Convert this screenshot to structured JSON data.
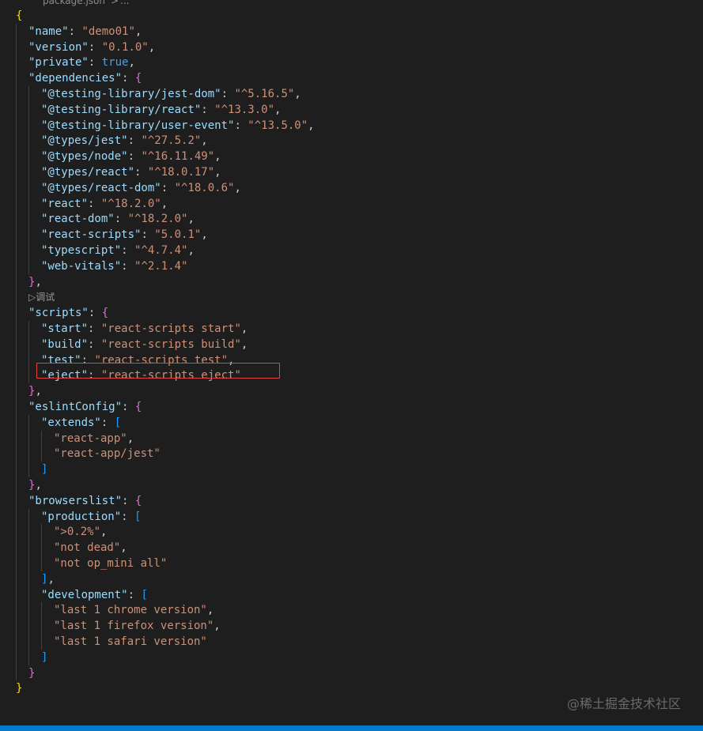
{
  "breadcrumb": {
    "file": "package.json",
    "separator": ">",
    "node": "..."
  },
  "codelens": {
    "label": "调试",
    "icon": "play-outline-icon"
  },
  "watermark": "@稀土掘金技术社区",
  "lines": [
    [
      [
        "b1",
        "{"
      ]
    ],
    [
      [
        "k",
        "\"name\""
      ],
      [
        "c",
        ": "
      ],
      [
        "s",
        "\"demo01\""
      ],
      [
        "c",
        ","
      ]
    ],
    [
      [
        "k",
        "\"version\""
      ],
      [
        "c",
        ": "
      ],
      [
        "s",
        "\"0.1.0\""
      ],
      [
        "c",
        ","
      ]
    ],
    [
      [
        "k",
        "\"private\""
      ],
      [
        "c",
        ": "
      ],
      [
        "kw",
        "true"
      ],
      [
        "c",
        ","
      ]
    ],
    [
      [
        "k",
        "\"dependencies\""
      ],
      [
        "c",
        ": "
      ],
      [
        "b2",
        "{"
      ]
    ],
    [
      [
        "k",
        "\"@testing-library/jest-dom\""
      ],
      [
        "c",
        ": "
      ],
      [
        "s",
        "\"^5.16.5\""
      ],
      [
        "c",
        ","
      ]
    ],
    [
      [
        "k",
        "\"@testing-library/react\""
      ],
      [
        "c",
        ": "
      ],
      [
        "s",
        "\"^13.3.0\""
      ],
      [
        "c",
        ","
      ]
    ],
    [
      [
        "k",
        "\"@testing-library/user-event\""
      ],
      [
        "c",
        ": "
      ],
      [
        "s",
        "\"^13.5.0\""
      ],
      [
        "c",
        ","
      ]
    ],
    [
      [
        "k",
        "\"@types/jest\""
      ],
      [
        "c",
        ": "
      ],
      [
        "s",
        "\"^27.5.2\""
      ],
      [
        "c",
        ","
      ]
    ],
    [
      [
        "k",
        "\"@types/node\""
      ],
      [
        "c",
        ": "
      ],
      [
        "s",
        "\"^16.11.49\""
      ],
      [
        "c",
        ","
      ]
    ],
    [
      [
        "k",
        "\"@types/react\""
      ],
      [
        "c",
        ": "
      ],
      [
        "s",
        "\"^18.0.17\""
      ],
      [
        "c",
        ","
      ]
    ],
    [
      [
        "k",
        "\"@types/react-dom\""
      ],
      [
        "c",
        ": "
      ],
      [
        "s",
        "\"^18.0.6\""
      ],
      [
        "c",
        ","
      ]
    ],
    [
      [
        "k",
        "\"react\""
      ],
      [
        "c",
        ": "
      ],
      [
        "s",
        "\"^18.2.0\""
      ],
      [
        "c",
        ","
      ]
    ],
    [
      [
        "k",
        "\"react-dom\""
      ],
      [
        "c",
        ": "
      ],
      [
        "s",
        "\"^18.2.0\""
      ],
      [
        "c",
        ","
      ]
    ],
    [
      [
        "k",
        "\"react-scripts\""
      ],
      [
        "c",
        ": "
      ],
      [
        "s",
        "\"5.0.1\""
      ],
      [
        "c",
        ","
      ]
    ],
    [
      [
        "k",
        "\"typescript\""
      ],
      [
        "c",
        ": "
      ],
      [
        "s",
        "\"^4.7.4\""
      ],
      [
        "c",
        ","
      ]
    ],
    [
      [
        "k",
        "\"web-vitals\""
      ],
      [
        "c",
        ": "
      ],
      [
        "s",
        "\"^2.1.4\""
      ]
    ],
    [
      [
        "b2",
        "}"
      ],
      [
        "c",
        ","
      ]
    ],
    [
      [
        "k",
        "\"scripts\""
      ],
      [
        "c",
        ": "
      ],
      [
        "b2",
        "{"
      ]
    ],
    [
      [
        "k",
        "\"start\""
      ],
      [
        "c",
        ": "
      ],
      [
        "s",
        "\"react-scripts start\""
      ],
      [
        "c",
        ","
      ]
    ],
    [
      [
        "k",
        "\"build\""
      ],
      [
        "c",
        ": "
      ],
      [
        "s",
        "\"react-scripts build\""
      ],
      [
        "c",
        ","
      ]
    ],
    [
      [
        "k",
        "\"test\""
      ],
      [
        "c",
        ": "
      ],
      [
        "s",
        "\"react-scripts test\""
      ],
      [
        "c",
        ","
      ]
    ],
    [
      [
        "k",
        "\"eject\""
      ],
      [
        "c",
        ": "
      ],
      [
        "s",
        "\"react-scripts eject\""
      ]
    ],
    [
      [
        "b2",
        "}"
      ],
      [
        "c",
        ","
      ]
    ],
    [
      [
        "k",
        "\"eslintConfig\""
      ],
      [
        "c",
        ": "
      ],
      [
        "b2",
        "{"
      ]
    ],
    [
      [
        "k",
        "\"extends\""
      ],
      [
        "c",
        ": "
      ],
      [
        "b3",
        "["
      ]
    ],
    [
      [
        "s",
        "\"react-app\""
      ],
      [
        "c",
        ","
      ]
    ],
    [
      [
        "s",
        "\"react-app/jest\""
      ]
    ],
    [
      [
        "b3",
        "]"
      ]
    ],
    [
      [
        "b2",
        "}"
      ],
      [
        "c",
        ","
      ]
    ],
    [
      [
        "k",
        "\"browserslist\""
      ],
      [
        "c",
        ": "
      ],
      [
        "b2",
        "{"
      ]
    ],
    [
      [
        "k",
        "\"production\""
      ],
      [
        "c",
        ": "
      ],
      [
        "b3",
        "["
      ]
    ],
    [
      [
        "s",
        "\">0.2%\""
      ],
      [
        "c",
        ","
      ]
    ],
    [
      [
        "s",
        "\"not dead\""
      ],
      [
        "c",
        ","
      ]
    ],
    [
      [
        "s",
        "\"not op_mini all\""
      ]
    ],
    [
      [
        "b3",
        "]"
      ],
      [
        "c",
        ","
      ]
    ],
    [
      [
        "k",
        "\"development\""
      ],
      [
        "c",
        ": "
      ],
      [
        "b3",
        "["
      ]
    ],
    [
      [
        "s",
        "\"last 1 chrome version\""
      ],
      [
        "c",
        ","
      ]
    ],
    [
      [
        "s",
        "\"last 1 firefox version\""
      ],
      [
        "c",
        ","
      ]
    ],
    [
      [
        "s",
        "\"last 1 safari version\""
      ]
    ],
    [
      [
        "b3",
        "]"
      ]
    ],
    [
      [
        "b2",
        "}"
      ]
    ],
    [
      [
        "b1",
        "}"
      ]
    ]
  ]
}
